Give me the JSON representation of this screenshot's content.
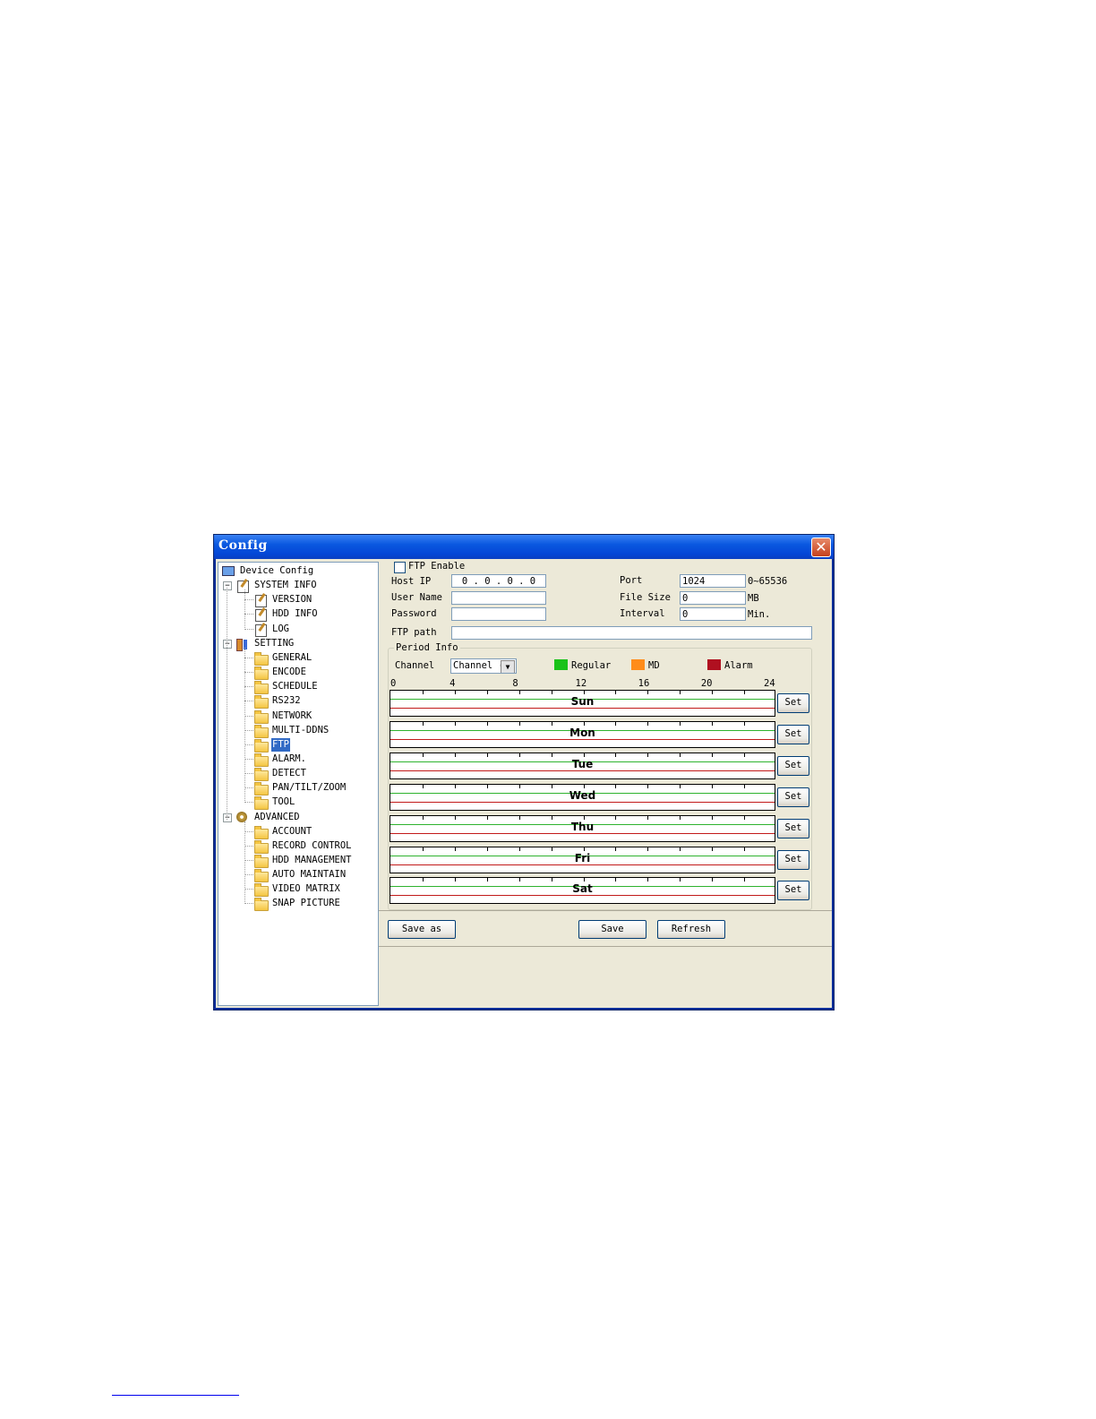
{
  "window": {
    "title": "Config",
    "close_glyph": "✕"
  },
  "tree": [
    {
      "label": "Device Config",
      "icon": "computer-icon",
      "level": 0
    },
    {
      "label": "SYSTEM INFO",
      "icon": "notepad-icon",
      "level": 1,
      "expander": "−"
    },
    {
      "label": "VERSION",
      "icon": "notepad-icon",
      "level": 2
    },
    {
      "label": "HDD INFO",
      "icon": "notepad-icon",
      "level": 2
    },
    {
      "label": "LOG",
      "icon": "notepad-icon",
      "level": 2
    },
    {
      "label": "SETTING",
      "icon": "tools-icon",
      "level": 1,
      "expander": "−"
    },
    {
      "label": "GENERAL",
      "icon": "folder-icon",
      "level": 2
    },
    {
      "label": "ENCODE",
      "icon": "folder-icon",
      "level": 2
    },
    {
      "label": "SCHEDULE",
      "icon": "folder-icon",
      "level": 2
    },
    {
      "label": "RS232",
      "icon": "folder-icon",
      "level": 2
    },
    {
      "label": "NETWORK",
      "icon": "folder-icon",
      "level": 2
    },
    {
      "label": "MULTI-DDNS",
      "icon": "folder-icon",
      "level": 2
    },
    {
      "label": "FTP",
      "icon": "folder-open-icon",
      "level": 2,
      "selected": true
    },
    {
      "label": "ALARM.",
      "icon": "folder-icon",
      "level": 2
    },
    {
      "label": "DETECT",
      "icon": "folder-icon",
      "level": 2
    },
    {
      "label": "PAN/TILT/ZOOM",
      "icon": "folder-icon",
      "level": 2
    },
    {
      "label": "TOOL",
      "icon": "folder-icon",
      "level": 2
    },
    {
      "label": "ADVANCED",
      "icon": "gears-icon",
      "level": 1,
      "expander": "−"
    },
    {
      "label": "ACCOUNT",
      "icon": "folder-icon",
      "level": 2
    },
    {
      "label": "RECORD CONTROL",
      "icon": "folder-icon",
      "level": 2
    },
    {
      "label": "HDD MANAGEMENT",
      "icon": "folder-icon",
      "level": 2
    },
    {
      "label": "AUTO MAINTAIN",
      "icon": "folder-icon",
      "level": 2
    },
    {
      "label": "VIDEO MATRIX",
      "icon": "folder-icon",
      "level": 2
    },
    {
      "label": "SNAP PICTURE",
      "icon": "folder-icon",
      "level": 2
    }
  ],
  "ftp": {
    "enable_label": "FTP Enable",
    "enabled": false,
    "host_ip_label": "Host IP",
    "host_ip_value": "0 . 0 . 0 . 0",
    "user_name_label": "User Name",
    "user_name_value": "",
    "password_label": "Password",
    "password_value": "",
    "ftp_path_label": "FTP path",
    "ftp_path_value": "",
    "port_label": "Port",
    "port_value": "1024",
    "port_range": "0~65536",
    "file_size_label": "File Size",
    "file_size_value": "0",
    "file_size_unit": "MB",
    "interval_label": "Interval",
    "interval_value": "0",
    "interval_unit": "Min."
  },
  "period": {
    "group_label": "Period Info",
    "channel_label": "Channel",
    "channel_value": "Channel (",
    "legend": [
      {
        "label": "Regular",
        "color": "#19c219"
      },
      {
        "label": "MD",
        "color": "#ff8c1a"
      },
      {
        "label": "Alarm",
        "color": "#b01020"
      }
    ],
    "hour_labels": [
      "0",
      "4",
      "8",
      "12",
      "16",
      "20",
      "24"
    ],
    "days": [
      "Sun",
      "Mon",
      "Tue",
      "Wed",
      "Thu",
      "Fri",
      "Sat"
    ],
    "set_label": "Set"
  },
  "buttons": {
    "save_as": "Save as",
    "save": "Save",
    "refresh": "Refresh"
  }
}
